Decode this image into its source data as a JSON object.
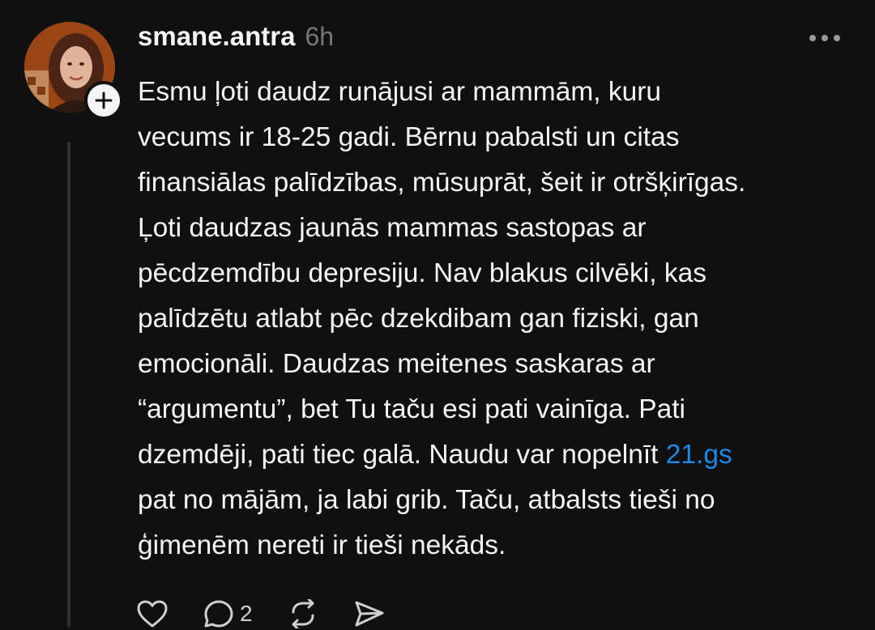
{
  "post": {
    "username": "smane.antra",
    "time": "6h",
    "body_lines": [
      "Esmu ļoti daudz runājusi ar mammām, kuru",
      "vecums ir 18-25 gadi. Bērnu pabalsti un citas",
      "finansiālas palīdzības, mūsuprāt, šeit ir otršķirīgas.",
      "Ļoti daudzas jaunās mammas sastopas ar",
      "pēcdzemdību depresiju. Nav blakus cilvēki, kas",
      "palīdzētu atlabt pēc dzekdibam gan fiziski, gan",
      "emocionāli. Daudzas meitenes saskaras ar",
      "“argumentu”, bet Tu taču esi pati vainīga. Pati"
    ],
    "line9_prefix": "dzemdēji, pati tiec galā. Naudu var nopelnīt ",
    "link_text": "21.gs",
    "body_lines_end": [
      "pat no mājām, ja labi grib. Taču, atbalsts tieši no",
      "ģimenēm nereti ir tieši nekāds."
    ],
    "reply_count": "2"
  },
  "colors": {
    "background": "#101010",
    "text": "#f3f5f7",
    "muted": "#777777",
    "link": "#1e88e5"
  },
  "icons": [
    "plus-icon",
    "more-icon",
    "heart-icon",
    "comment-icon",
    "repost-icon",
    "share-icon"
  ]
}
